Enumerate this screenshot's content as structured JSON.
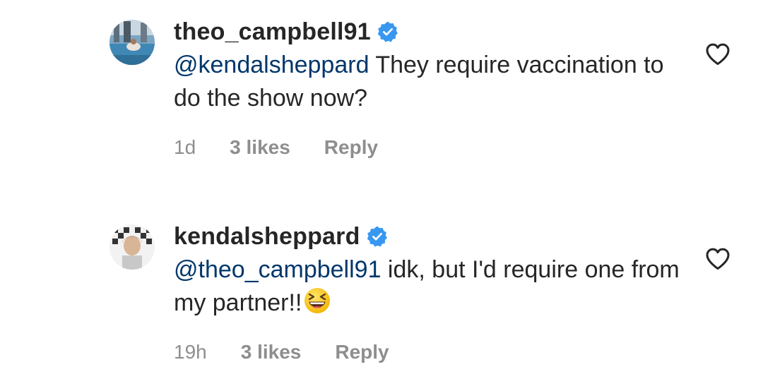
{
  "comments": [
    {
      "username": "theo_campbell91",
      "verified": true,
      "mention": "@kendalsheppard",
      "text": " They require vaccination to do the show now?",
      "time": "1d",
      "likes": "3 likes",
      "reply_label": "Reply",
      "avatar_icon": "profile-photo-beach-pool"
    },
    {
      "username": "kendalsheppard",
      "verified": true,
      "mention": "@theo_campbell91",
      "text": " idk, but I'd require one from my partner!!",
      "emoji": "grinning-squinting-face-emoji",
      "time": "19h",
      "likes": "3 likes",
      "reply_label": "Reply",
      "avatar_icon": "profile-photo-checkered-background"
    }
  ],
  "colors": {
    "text": "#262626",
    "mention": "#00376b",
    "meta": "#8e8e8e",
    "verified": "#3897f0"
  }
}
